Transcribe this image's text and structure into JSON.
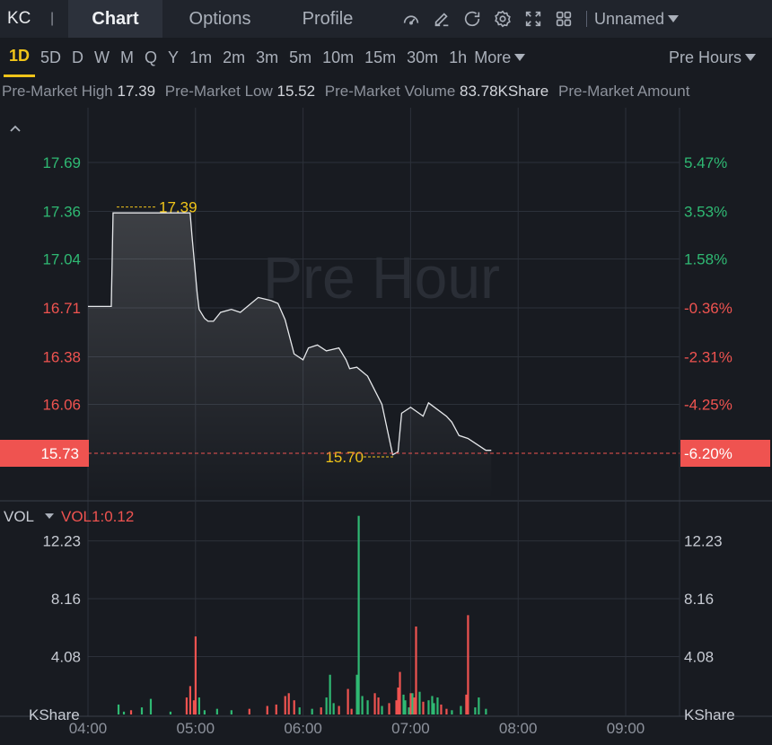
{
  "header": {
    "ticker": "KC",
    "separator": "|",
    "tabs": [
      {
        "label": "Chart",
        "active": true
      },
      {
        "label": "Options",
        "active": false
      },
      {
        "label": "Profile",
        "active": false
      }
    ],
    "layout_name": "Unnamed",
    "icons": [
      "gauge-icon",
      "draw-icon",
      "refresh-icon",
      "settings-icon",
      "fullscreen-icon",
      "grid-layout-icon"
    ]
  },
  "intervals": {
    "items": [
      "1D",
      "5D",
      "D",
      "W",
      "M",
      "Q",
      "Y",
      "1m",
      "2m",
      "3m",
      "5m",
      "10m",
      "15m",
      "30m",
      "1h"
    ],
    "active": "1D",
    "more_label": "More",
    "session_label": "Pre Hours"
  },
  "stats": [
    {
      "label": "Pre-Market High",
      "value": "17.39"
    },
    {
      "label": "Pre-Market Low",
      "value": "15.52"
    },
    {
      "label": "Pre-Market Volume",
      "value": "83.78KShare"
    },
    {
      "label": "Pre-Market Amount",
      "value": ""
    }
  ],
  "colors": {
    "background": "#181b21",
    "up": "#2fb973",
    "down": "#ef5350",
    "grid": "#2c313a",
    "highlight": "#f0c419",
    "line": "#e6e8eb"
  },
  "chart_data": [
    {
      "type": "line",
      "watermark": "Pre Hour",
      "x_ticks": [
        "04:00",
        "05:00",
        "06:00",
        "07:00",
        "08:00",
        "09:00"
      ],
      "y_ticks": [
        "17.69",
        "17.36",
        "17.04",
        "16.71",
        "16.38",
        "16.06"
      ],
      "y_ticks_right": [
        "5.47%",
        "3.53%",
        "1.58%",
        "-0.36%",
        "-2.31%",
        "-4.25%"
      ],
      "ylim": [
        15.73,
        17.69
      ],
      "current_price": "15.73",
      "current_change": "-6.20%",
      "high_label": "17.39",
      "low_label": "15.70",
      "x": [
        "04:00",
        "04:13",
        "04:14",
        "04:57",
        "04:58",
        "05:01",
        "05:02",
        "05:05",
        "05:07",
        "05:10",
        "05:14",
        "05:20",
        "05:25",
        "05:35",
        "05:42",
        "05:46",
        "05:50",
        "05:55",
        "06:00",
        "06:03",
        "06:08",
        "06:13",
        "06:20",
        "06:24",
        "06:26",
        "06:30",
        "06:36",
        "06:44",
        "06:50",
        "06:53",
        "06:55",
        "07:00",
        "07:07",
        "07:10",
        "07:20",
        "07:23",
        "07:27",
        "07:32",
        "07:37",
        "07:42",
        "07:45"
      ],
      "values": [
        16.72,
        16.72,
        17.35,
        17.35,
        17.2,
        16.8,
        16.7,
        16.64,
        16.62,
        16.62,
        16.68,
        16.7,
        16.68,
        16.78,
        16.76,
        16.74,
        16.63,
        16.4,
        16.36,
        16.44,
        16.46,
        16.42,
        16.44,
        16.36,
        16.3,
        16.31,
        16.25,
        16.06,
        15.72,
        15.74,
        16.0,
        16.04,
        15.98,
        16.07,
        15.98,
        15.94,
        15.85,
        15.83,
        15.79,
        15.75,
        15.75
      ]
    },
    {
      "type": "bar",
      "indicator_label": "VOL",
      "indicator_value": "VOL1:0.12",
      "y_ticks": [
        "12.23",
        "8.16",
        "4.08"
      ],
      "y_unit": "KShare",
      "ylim": [
        0,
        15.5
      ],
      "bars": [
        {
          "t": "04:17",
          "v": 0.7,
          "up": true
        },
        {
          "t": "04:20",
          "v": 0.2,
          "up": true
        },
        {
          "t": "04:24",
          "v": 0.3,
          "up": false
        },
        {
          "t": "04:30",
          "v": 0.5,
          "up": true
        },
        {
          "t": "04:35",
          "v": 1.1,
          "up": true
        },
        {
          "t": "04:46",
          "v": 0.2,
          "up": true
        },
        {
          "t": "04:55",
          "v": 1.2,
          "up": false
        },
        {
          "t": "04:57",
          "v": 2.0,
          "up": false
        },
        {
          "t": "04:59",
          "v": 1.0,
          "up": false
        },
        {
          "t": "05:00",
          "v": 5.5,
          "up": false
        },
        {
          "t": "05:02",
          "v": 1.2,
          "up": true
        },
        {
          "t": "05:05",
          "v": 0.3,
          "up": true
        },
        {
          "t": "05:12",
          "v": 0.4,
          "up": true
        },
        {
          "t": "05:20",
          "v": 0.3,
          "up": true
        },
        {
          "t": "05:30",
          "v": 0.4,
          "up": false
        },
        {
          "t": "05:40",
          "v": 0.6,
          "up": false
        },
        {
          "t": "05:45",
          "v": 0.7,
          "up": false
        },
        {
          "t": "05:50",
          "v": 1.3,
          "up": false
        },
        {
          "t": "05:52",
          "v": 1.5,
          "up": false
        },
        {
          "t": "05:55",
          "v": 1.0,
          "up": false
        },
        {
          "t": "05:58",
          "v": 0.5,
          "up": true
        },
        {
          "t": "06:05",
          "v": 0.4,
          "up": true
        },
        {
          "t": "06:10",
          "v": 0.5,
          "up": false
        },
        {
          "t": "06:13",
          "v": 1.2,
          "up": true
        },
        {
          "t": "06:15",
          "v": 2.8,
          "up": true
        },
        {
          "t": "06:17",
          "v": 0.8,
          "up": true
        },
        {
          "t": "06:20",
          "v": 0.6,
          "up": false
        },
        {
          "t": "06:25",
          "v": 1.8,
          "up": false
        },
        {
          "t": "06:27",
          "v": 0.4,
          "up": false
        },
        {
          "t": "06:30",
          "v": 2.8,
          "up": true
        },
        {
          "t": "06:31",
          "v": 14.0,
          "up": true
        },
        {
          "t": "06:33",
          "v": 1.3,
          "up": true
        },
        {
          "t": "06:36",
          "v": 1.0,
          "up": true
        },
        {
          "t": "06:40",
          "v": 1.5,
          "up": false
        },
        {
          "t": "06:42",
          "v": 1.2,
          "up": false
        },
        {
          "t": "06:44",
          "v": 0.6,
          "up": true
        },
        {
          "t": "06:48",
          "v": 0.8,
          "up": false
        },
        {
          "t": "06:52",
          "v": 1.0,
          "up": false
        },
        {
          "t": "06:53",
          "v": 1.9,
          "up": false
        },
        {
          "t": "06:54",
          "v": 3.0,
          "up": false
        },
        {
          "t": "06:56",
          "v": 1.4,
          "up": true
        },
        {
          "t": "06:57",
          "v": 1.0,
          "up": true
        },
        {
          "t": "06:59",
          "v": 0.5,
          "up": true
        },
        {
          "t": "07:00",
          "v": 1.5,
          "up": false
        },
        {
          "t": "07:01",
          "v": 1.5,
          "up": true
        },
        {
          "t": "07:02",
          "v": 1.2,
          "up": false
        },
        {
          "t": "07:03",
          "v": 6.2,
          "up": false
        },
        {
          "t": "07:05",
          "v": 1.6,
          "up": true
        },
        {
          "t": "07:07",
          "v": 0.9,
          "up": false
        },
        {
          "t": "07:10",
          "v": 1.0,
          "up": true
        },
        {
          "t": "07:12",
          "v": 1.3,
          "up": true
        },
        {
          "t": "07:13",
          "v": 0.8,
          "up": true
        },
        {
          "t": "07:15",
          "v": 1.2,
          "up": true
        },
        {
          "t": "07:17",
          "v": 0.7,
          "up": false
        },
        {
          "t": "07:20",
          "v": 0.4,
          "up": false
        },
        {
          "t": "07:23",
          "v": 0.3,
          "up": true
        },
        {
          "t": "07:28",
          "v": 0.6,
          "up": true
        },
        {
          "t": "07:31",
          "v": 1.4,
          "up": false
        },
        {
          "t": "07:32",
          "v": 7.0,
          "up": false
        },
        {
          "t": "07:36",
          "v": 0.5,
          "up": true
        },
        {
          "t": "07:38",
          "v": 1.2,
          "up": true
        },
        {
          "t": "07:42",
          "v": 0.4,
          "up": true
        }
      ]
    }
  ]
}
